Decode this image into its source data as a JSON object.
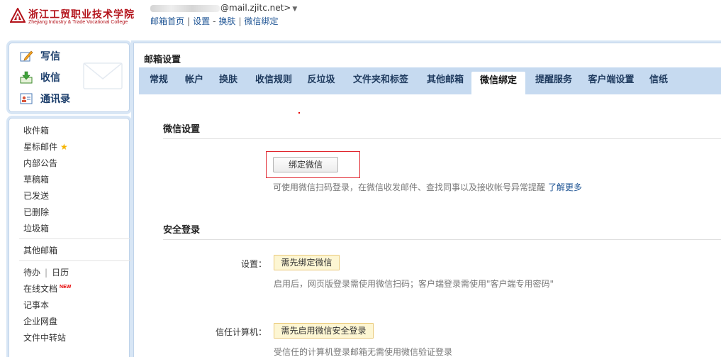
{
  "header": {
    "logo_cn": "浙江工贸职业技术学院",
    "logo_en": "Zhejiang Industry & Trade Vocational College",
    "user_email_suffix": "@mail.zjitc.net>",
    "links": [
      "邮箱首页",
      "设置",
      "换肤",
      "微信绑定"
    ],
    "link_separators": [
      "|",
      "-",
      "|"
    ]
  },
  "compose": {
    "write": "写信",
    "receive": "收信",
    "contacts": "通讯录"
  },
  "folders": {
    "inbox": "收件箱",
    "starred": "星标邮件",
    "notice": "内部公告",
    "drafts": "草稿箱",
    "sent": "已发送",
    "deleted": "已删除",
    "spam": "垃圾箱",
    "other_mailbox": "其他邮箱",
    "todo": "待办",
    "todo_sep": "|",
    "calendar": "日历",
    "online_docs": "在线文档",
    "new_badge": "NEW",
    "notes": "记事本",
    "netdisk": "企业网盘",
    "transfer": "文件中转站"
  },
  "main": {
    "title": "邮箱设置",
    "tabs": [
      "常规",
      "帐户",
      "换肤",
      "收信规则",
      "反垃圾",
      "文件夹和标签",
      "其他邮箱",
      "微信绑定",
      "提醒服务",
      "客户端设置",
      "信纸"
    ],
    "active_tab": "微信绑定"
  },
  "wechat_section": {
    "title": "微信设置",
    "bind_button": "绑定微信",
    "hint": "可使用微信扫码登录，在微信收发邮件、查找同事以及接收帐号异常提醒",
    "learn_more": "了解更多"
  },
  "security_section": {
    "title": "安全登录",
    "setting_label": "设置：",
    "setting_button": "需先绑定微信",
    "setting_hint": "启用后，网页版登录需使用微信扫码；客户端登录需使用\"客户端专用密码\"",
    "trusted_label": "信任计算机：",
    "trusted_button": "需先启用微信安全登录",
    "trusted_hint": "受信任的计算机登录邮箱无需使用微信验证登录"
  },
  "colors": {
    "accent_red": "#e0242c",
    "tab_bar": "#c6daf0",
    "link_blue": "#1e5494",
    "warn_bg": "#fdf6d3"
  }
}
